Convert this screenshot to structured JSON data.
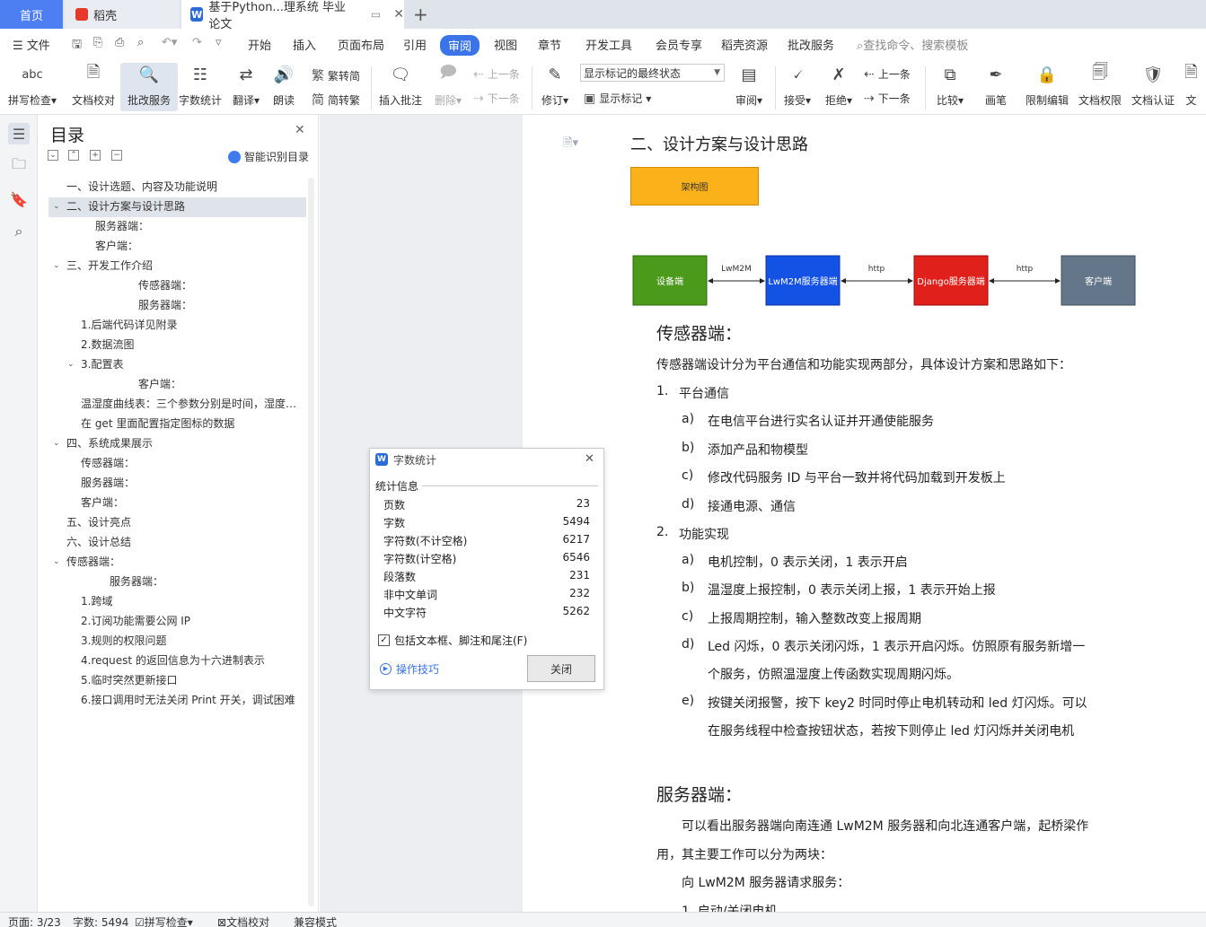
{
  "tabs": {
    "home": "首页",
    "daoke": "稻壳",
    "doc": "基于Python...理系统 毕业论文",
    "new_tab": "+"
  },
  "menu": {
    "file": "文件",
    "items": [
      "开始",
      "插入",
      "页面布局",
      "引用",
      "审阅",
      "视图",
      "章节",
      "开发工具",
      "会员专享",
      "稻壳资源",
      "批改服务"
    ],
    "search_placeholder": "查找命令、搜索模板"
  },
  "toolbar": {
    "spellcheck": "拼写检查",
    "doc_proof": "文档校对",
    "review_service": "批改服务",
    "word_count": "字数统计",
    "translate": "翻译",
    "read_aloud": "朗读",
    "trad": "繁转简",
    "simp": "简转繁",
    "insert_comment": "插入批注",
    "delete": "删除",
    "prev_comment": "上一条",
    "next_comment": "下一条",
    "track": "修订",
    "markup_select": "显示标记的最终状态",
    "show_markup": "显示标记",
    "review": "审阅",
    "accept": "接受",
    "reject": "拒绝",
    "prev_change": "上一条",
    "next_change": "下一条",
    "compare": "比较",
    "pen": "画笔",
    "restrict": "限制编辑",
    "doc_rights": "文档权限",
    "doc_auth": "文档认证",
    "more": "文"
  },
  "toc": {
    "title": "目录",
    "smart": "智能识别目录",
    "items": [
      "一、设计选题、内容及功能说明",
      "二、设计方案与设计思路",
      "服务器端：",
      "客户端：",
      "三、开发工作介绍",
      "传感器端：",
      "服务器端：",
      "1.后端代码详见附录",
      "2.数据流图",
      "3.配置表",
      "客户端：",
      "温湿度曲线表：三个参数分别是时间，湿度，温度",
      "在 get 里面配置指定图标的数据",
      "四、系统成果展示",
      "传感器端：",
      "服务器端：",
      "客户端：",
      "五、设计亮点",
      "六、设计总结",
      "传感器端：",
      "服务器端：",
      "1.跨域",
      "2.订阅功能需要公网 IP",
      "3.规则的权限问题",
      "4.request 的返回信息为十六进制表示",
      "5.临时突然更新接口",
      "6.接口调用时无法关闭 Print 开关，调试困难"
    ]
  },
  "document": {
    "heading2": "二、设计方案与设计思路",
    "arch_label": "架构图",
    "diagram": {
      "device": "设备端",
      "server": "LwM2M服务器端",
      "django": "Django服务器端",
      "client": "客户端",
      "link1": "LwM2M",
      "link2": "http",
      "link3": "http"
    },
    "sensor_heading": "传感器端：",
    "sensor_intro": "传感器端设计分为平台通信和功能实现两部分，具体设计方案和思路如下：",
    "list1_num": "1.",
    "list1_title": "平台通信",
    "list1": [
      {
        "m": "a)",
        "t": "在电信平台进行实名认证并开通使能服务"
      },
      {
        "m": "b)",
        "t": "添加产品和物模型"
      },
      {
        "m": "c)",
        "t": "修改代码服务 ID 与平台一致并将代码加载到开发板上"
      },
      {
        "m": "d)",
        "t": "接通电源、通信"
      }
    ],
    "list2_num": "2.",
    "list2_title": "功能实现",
    "list2": [
      {
        "m": "a)",
        "t": "电机控制，0 表示关闭，1 表示开启"
      },
      {
        "m": "b)",
        "t": "温湿度上报控制，0 表示关闭上报，1 表示开始上报"
      },
      {
        "m": "c)",
        "t": "上报周期控制，输入整数改变上报周期"
      },
      {
        "m": "d)",
        "t": "Led 闪烁，0 表示关闭闪烁，1 表示开启闪烁。仿照原有服务新增一"
      },
      {
        "m": "",
        "t": "个服务，仿照温湿度上传函数实现周期闪烁。"
      },
      {
        "m": "e)",
        "t": "按键关闭报警，按下 key2 时同时停止电机转动和 led 灯闪烁。可以"
      },
      {
        "m": "",
        "t": "在服务线程中检查按钮状态，若按下则停止 led 灯闪烁并关闭电机"
      }
    ],
    "server_heading": "服务器端：",
    "server_p1": "可以看出服务器端向南连通 LwM2M 服务器和向北连通客户端，起桥梁作",
    "server_p2": "用，其主要工作可以分为两块：",
    "server_p3": "向 LwM2M 服务器请求服务：",
    "server_p4": "1.  启动/关闭电机"
  },
  "dialog": {
    "title": "字数统计",
    "section": "统计信息",
    "rows": [
      {
        "k": "页数",
        "v": "23"
      },
      {
        "k": "字数",
        "v": "5494"
      },
      {
        "k": "字符数(不计空格)",
        "v": "6217"
      },
      {
        "k": "字符数(计空格)",
        "v": "6546"
      },
      {
        "k": "段落数",
        "v": "231"
      },
      {
        "k": "非中文单词",
        "v": "232"
      },
      {
        "k": "中文字符",
        "v": "5262"
      }
    ],
    "include": "包括文本框、脚注和尾注(F)",
    "tips": "操作技巧",
    "close": "关闭"
  },
  "status": {
    "page": "页面: 3/23",
    "words": "字数: 5494",
    "spell": "拼写检查",
    "proof": "文档校对",
    "compat": "兼容模式"
  },
  "colors": {
    "accent": "#3a74e8",
    "device_box": "#4b9a1c",
    "server_box": "#1452e6",
    "django_box": "#e0201b",
    "client_box": "#647689",
    "arch_box": "#fbb21a"
  }
}
